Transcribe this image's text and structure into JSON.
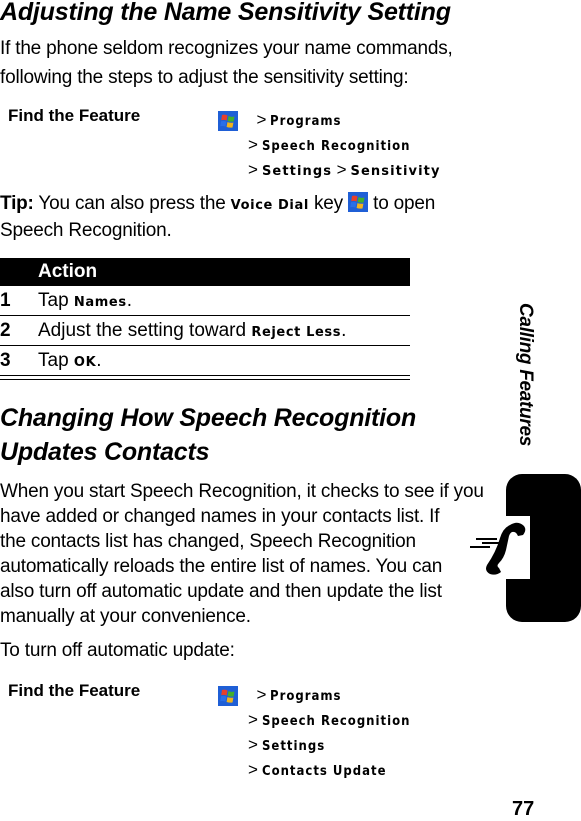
{
  "section1": {
    "title": "Adjusting the Name Sensitivity Setting",
    "intro": [
      "If the phone seldom recognizes your name commands,",
      "following the steps to adjust the sensitivity setting:"
    ],
    "find_feature": {
      "label": "Find the Feature",
      "icon": "windows-start-icon",
      "path": [
        [
          "Programs"
        ],
        [
          "Speech Recognition"
        ],
        [
          "Settings",
          "Sensitivity"
        ]
      ]
    },
    "tip": {
      "label": "Tip:",
      "text_before": " You can also press the ",
      "key_name": "Voice Dial",
      "text_mid": " key ",
      "text_after": " to open",
      "line2": "Speech Recognition."
    },
    "table": {
      "header": "Action",
      "rows": [
        {
          "num": "1",
          "pre": "Tap ",
          "ui": "Names",
          "post": "."
        },
        {
          "num": "2",
          "pre": "Adjust the setting toward ",
          "ui": "Reject Less",
          "post": "."
        },
        {
          "num": "3",
          "pre": "Tap ",
          "ui": "OK",
          "post": "."
        }
      ]
    }
  },
  "section2": {
    "title_lines": [
      "Changing How Speech Recognition",
      "Updates Contacts"
    ],
    "paragraph": [
      "When you start Speech Recognition, it checks to see if you",
      "have added or changed names in your contacts list. If",
      "the contacts list has changed, Speech Recognition",
      "automatically reloads the entire list of names. You can",
      "also turn off automatic update and then update the list",
      "manually at your convenience."
    ],
    "lead": "To turn off automatic update:",
    "find_feature": {
      "label": "Find the Feature",
      "icon": "windows-start-icon",
      "path": [
        [
          "Programs"
        ],
        [
          "Speech Recognition"
        ],
        [
          "Settings"
        ],
        [
          "Contacts Update"
        ]
      ]
    }
  },
  "sidebar": {
    "chapter_title": "Calling Features",
    "chapter_icon": "phone-handset-icon"
  },
  "page_number": "77",
  "separator": ">"
}
